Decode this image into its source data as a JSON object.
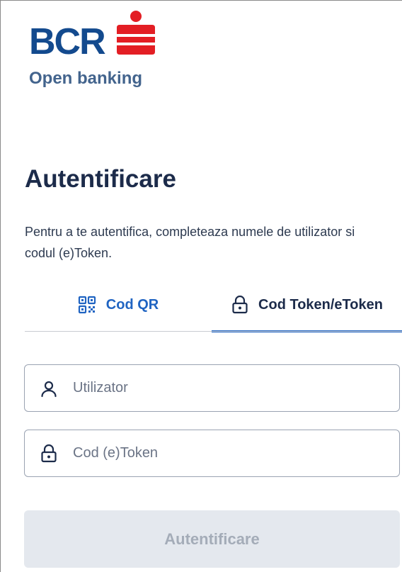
{
  "logo": {
    "brand_text": "BCR",
    "subtitle": "Open banking",
    "colors": {
      "brand_blue": "#134a8e",
      "mark_red": "#e31e24",
      "subtitle": "#43648d"
    }
  },
  "auth": {
    "title": "Autentificare",
    "description": "Pentru a te autentifica, completeaza numele de utilizator si codul (e)Token."
  },
  "tabs": [
    {
      "label": "Cod QR",
      "icon": "qr-code-icon",
      "active": false
    },
    {
      "label": "Cod Token/eToken",
      "icon": "lock-icon",
      "active": true
    }
  ],
  "form": {
    "username": {
      "placeholder": "Utilizator",
      "value": "",
      "icon": "user-icon"
    },
    "token": {
      "placeholder": "Cod (e)Token",
      "value": "",
      "icon": "lock-icon"
    },
    "submit_label": "Autentificare",
    "submit_enabled": false
  },
  "colors": {
    "accent": "#2064c2",
    "heading": "#1c2b4a",
    "disabled_bg": "#e4e8ee",
    "disabled_text": "#a4acb8"
  }
}
